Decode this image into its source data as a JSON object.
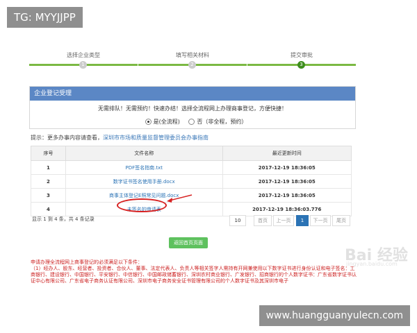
{
  "overlay": {
    "tag": "TG: MYYJJPP",
    "site": "www.huangguanyulecn.com"
  },
  "steps": [
    {
      "number": "1",
      "label": "选择企业类型"
    },
    {
      "number": "2",
      "label": "填写相关材料"
    },
    {
      "number": "3",
      "label": "提交审批"
    }
  ],
  "panel": {
    "title": "企业登记受理",
    "notice": "无需排队！无需预约！快速办结！选择全流程网上办理商事登记，方便快捷！",
    "option_yes": "是(全流程)",
    "option_no": "否（非全程，预约）"
  },
  "tip": {
    "prefix": "提示：更多办事内容请查看，",
    "link": "深圳市市场和质量监督管理委员会办事指南"
  },
  "table": {
    "headers": [
      "序号",
      "文件名称",
      "最近更新时间"
    ],
    "rows": [
      {
        "no": "1",
        "name": "PDF签名指南.txt",
        "time": "2017-12-19 18:36:05"
      },
      {
        "no": "2",
        "name": "数字证书签名使用手册.docx",
        "time": "2017-12-19 18:36:05"
      },
      {
        "no": "3",
        "name": "商事主体登记E照常见问题.docx",
        "time": "2017-12-19 18:36:05"
      },
      {
        "no": "4",
        "name": "未签名的申请表",
        "time": "2017-12-19 18:36:03.776"
      }
    ]
  },
  "pagination": {
    "summary": "显示 1 到 4 条，共 4 条记录",
    "page_size": "10",
    "first": "首页",
    "prev": "上一页",
    "current": "1",
    "next": "下一页",
    "last": "尾页"
  },
  "return_button": "返回首页页面",
  "conditions": {
    "line1": "申请办理全流程网上商事登记的必须满足以下条件：",
    "line2": "（1）经办人、股东、经营者、投资者、合伙人、董事、法定代表人、负责人等相关签字人需持有开网兼使用以下数字证书进行身份认证和电子签名：工商银行、建设银行、中国银行、平安银行、中信银行、中国邮政储蓄银行、深圳农村商业银行、广发银行、招商银行的个人数字证书：广东省数字证书认证中心有限公司、广东省电子商务认证有限公司、深圳市电子商务安全证书管理有限公司的个人数字证书及其深圳市电子"
  },
  "watermark": {
    "brand": "Bai 经验",
    "sub": "jingyan.baidu.com"
  },
  "colors": {
    "header_blue": "#5b87c5",
    "step_green": "#3e8e1e",
    "link_blue": "#2b73b5",
    "alert_red": "#cc2222",
    "button_green": "#5ec15e"
  }
}
